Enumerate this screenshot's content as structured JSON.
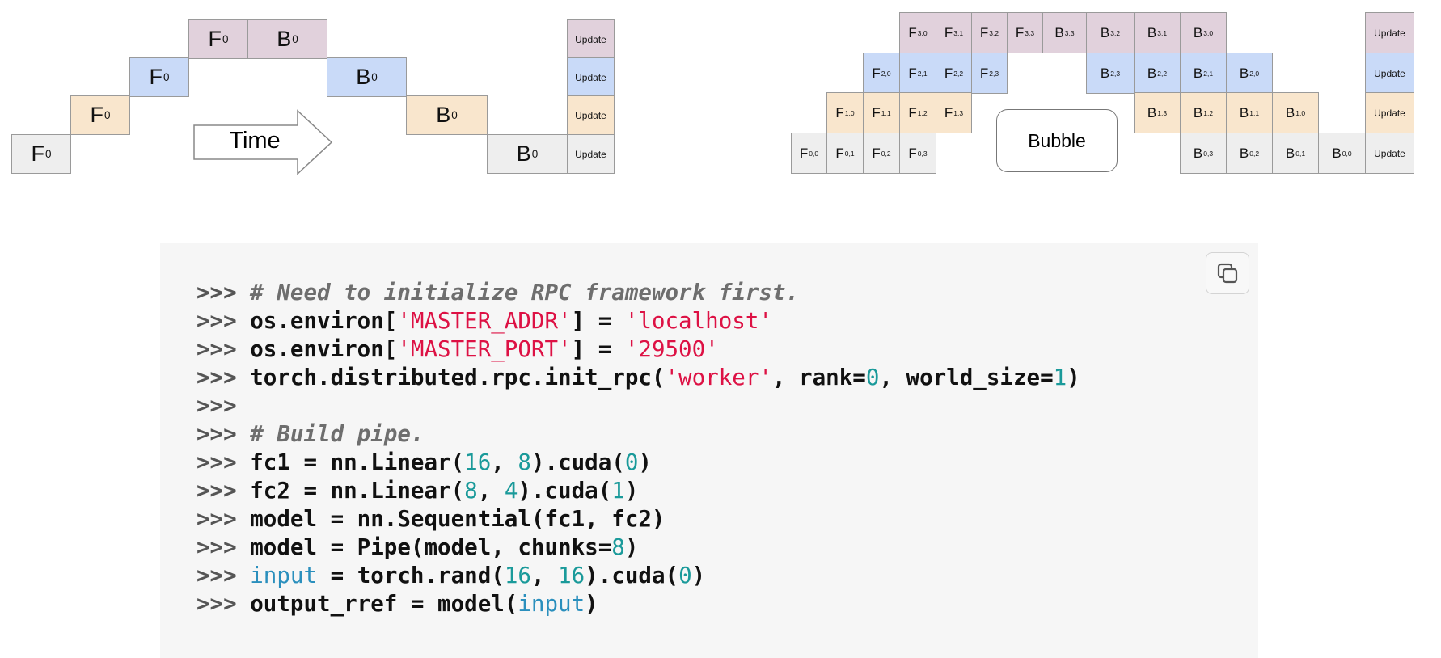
{
  "colors": {
    "stage3": "#e1d1dc",
    "stage2": "#c9daf8",
    "stage1": "#f9e6cd",
    "stage0": "#eeeeee"
  },
  "left_diagram": {
    "time_label": "Time",
    "cells": [
      {
        "stage": 3,
        "op": "F",
        "sub": "0"
      },
      {
        "stage": 3,
        "op": "B",
        "sub": "0"
      },
      {
        "stage": 3,
        "op": "Update",
        "sub": ""
      },
      {
        "stage": 2,
        "op": "F",
        "sub": "0"
      },
      {
        "stage": 2,
        "op": "B",
        "sub": "0"
      },
      {
        "stage": 2,
        "op": "Update",
        "sub": ""
      },
      {
        "stage": 1,
        "op": "F",
        "sub": "0"
      },
      {
        "stage": 1,
        "op": "B",
        "sub": "0"
      },
      {
        "stage": 1,
        "op": "Update",
        "sub": ""
      },
      {
        "stage": 0,
        "op": "F",
        "sub": "0"
      },
      {
        "stage": 0,
        "op": "B",
        "sub": "0"
      },
      {
        "stage": 0,
        "op": "Update",
        "sub": ""
      }
    ]
  },
  "right_diagram": {
    "bubble_label": "Bubble",
    "cells": [
      {
        "stage": 3,
        "op": "F",
        "sub": "3,0"
      },
      {
        "stage": 3,
        "op": "F",
        "sub": "3,1"
      },
      {
        "stage": 3,
        "op": "F",
        "sub": "3,2"
      },
      {
        "stage": 3,
        "op": "F",
        "sub": "3,3"
      },
      {
        "stage": 3,
        "op": "B",
        "sub": "3,3"
      },
      {
        "stage": 3,
        "op": "B",
        "sub": "3,2"
      },
      {
        "stage": 3,
        "op": "B",
        "sub": "3,1"
      },
      {
        "stage": 3,
        "op": "B",
        "sub": "3,0"
      },
      {
        "stage": 3,
        "op": "Update",
        "sub": ""
      },
      {
        "stage": 2,
        "op": "F",
        "sub": "2,0"
      },
      {
        "stage": 2,
        "op": "F",
        "sub": "2,1"
      },
      {
        "stage": 2,
        "op": "F",
        "sub": "2,2"
      },
      {
        "stage": 2,
        "op": "F",
        "sub": "2,3"
      },
      {
        "stage": 2,
        "op": "B",
        "sub": "2,3"
      },
      {
        "stage": 2,
        "op": "B",
        "sub": "2,2"
      },
      {
        "stage": 2,
        "op": "B",
        "sub": "2,1"
      },
      {
        "stage": 2,
        "op": "B",
        "sub": "2,0"
      },
      {
        "stage": 2,
        "op": "Update",
        "sub": ""
      },
      {
        "stage": 1,
        "op": "F",
        "sub": "1,0"
      },
      {
        "stage": 1,
        "op": "F",
        "sub": "1,1"
      },
      {
        "stage": 1,
        "op": "F",
        "sub": "1,2"
      },
      {
        "stage": 1,
        "op": "F",
        "sub": "1,3"
      },
      {
        "stage": 1,
        "op": "B",
        "sub": "1,3"
      },
      {
        "stage": 1,
        "op": "B",
        "sub": "1,2"
      },
      {
        "stage": 1,
        "op": "B",
        "sub": "1,1"
      },
      {
        "stage": 1,
        "op": "B",
        "sub": "1,0"
      },
      {
        "stage": 1,
        "op": "Update",
        "sub": ""
      },
      {
        "stage": 0,
        "op": "F",
        "sub": "0,0"
      },
      {
        "stage": 0,
        "op": "F",
        "sub": "0,1"
      },
      {
        "stage": 0,
        "op": "F",
        "sub": "0,2"
      },
      {
        "stage": 0,
        "op": "F",
        "sub": "0,3"
      },
      {
        "stage": 0,
        "op": "B",
        "sub": "0,3"
      },
      {
        "stage": 0,
        "op": "B",
        "sub": "0,2"
      },
      {
        "stage": 0,
        "op": "B",
        "sub": "0,1"
      },
      {
        "stage": 0,
        "op": "B",
        "sub": "0,0"
      },
      {
        "stage": 0,
        "op": "Update",
        "sub": ""
      }
    ]
  },
  "code_block": {
    "copy_icon": "copy-icon",
    "lines": [
      [
        [
          "prompt",
          ">>> "
        ],
        [
          "comment",
          "# Need to initialize RPC framework first."
        ]
      ],
      [
        [
          "prompt",
          ">>> "
        ],
        [
          "plain",
          "os.environ["
        ],
        [
          "string",
          "'MASTER_ADDR'"
        ],
        [
          "plain",
          "] = "
        ],
        [
          "string",
          "'localhost'"
        ]
      ],
      [
        [
          "prompt",
          ">>> "
        ],
        [
          "plain",
          "os.environ["
        ],
        [
          "string",
          "'MASTER_PORT'"
        ],
        [
          "plain",
          "] = "
        ],
        [
          "string",
          "'29500'"
        ]
      ],
      [
        [
          "prompt",
          ">>> "
        ],
        [
          "plain",
          "torch.distributed.rpc.init_rpc("
        ],
        [
          "string",
          "'worker'"
        ],
        [
          "plain",
          ", rank="
        ],
        [
          "number",
          "0"
        ],
        [
          "plain",
          ", world_size="
        ],
        [
          "number",
          "1"
        ],
        [
          "plain",
          ")"
        ]
      ],
      [
        [
          "prompt",
          ">>>"
        ]
      ],
      [
        [
          "prompt",
          ">>> "
        ],
        [
          "comment",
          "# Build pipe."
        ]
      ],
      [
        [
          "prompt",
          ">>> "
        ],
        [
          "plain",
          "fc1 = nn.Linear("
        ],
        [
          "number",
          "16"
        ],
        [
          "plain",
          ", "
        ],
        [
          "number",
          "8"
        ],
        [
          "plain",
          ").cuda("
        ],
        [
          "number",
          "0"
        ],
        [
          "plain",
          ")"
        ]
      ],
      [
        [
          "prompt",
          ">>> "
        ],
        [
          "plain",
          "fc2 = nn.Linear("
        ],
        [
          "number",
          "8"
        ],
        [
          "plain",
          ", "
        ],
        [
          "number",
          "4"
        ],
        [
          "plain",
          ").cuda("
        ],
        [
          "number",
          "1"
        ],
        [
          "plain",
          ")"
        ]
      ],
      [
        [
          "prompt",
          ">>> "
        ],
        [
          "plain",
          "model = nn.Sequential(fc1, fc2)"
        ]
      ],
      [
        [
          "prompt",
          ">>> "
        ],
        [
          "plain",
          "model = Pipe(model, chunks="
        ],
        [
          "number",
          "8"
        ],
        [
          "plain",
          ")"
        ]
      ],
      [
        [
          "prompt",
          ">>> "
        ],
        [
          "builtin",
          "input"
        ],
        [
          "plain",
          " = torch.rand("
        ],
        [
          "number",
          "16"
        ],
        [
          "plain",
          ", "
        ],
        [
          "number",
          "16"
        ],
        [
          "plain",
          ").cuda("
        ],
        [
          "number",
          "0"
        ],
        [
          "plain",
          ")"
        ]
      ],
      [
        [
          "prompt",
          ">>> "
        ],
        [
          "plain",
          "output_rref = model("
        ],
        [
          "builtin",
          "input"
        ],
        [
          "plain",
          ")"
        ]
      ]
    ]
  }
}
